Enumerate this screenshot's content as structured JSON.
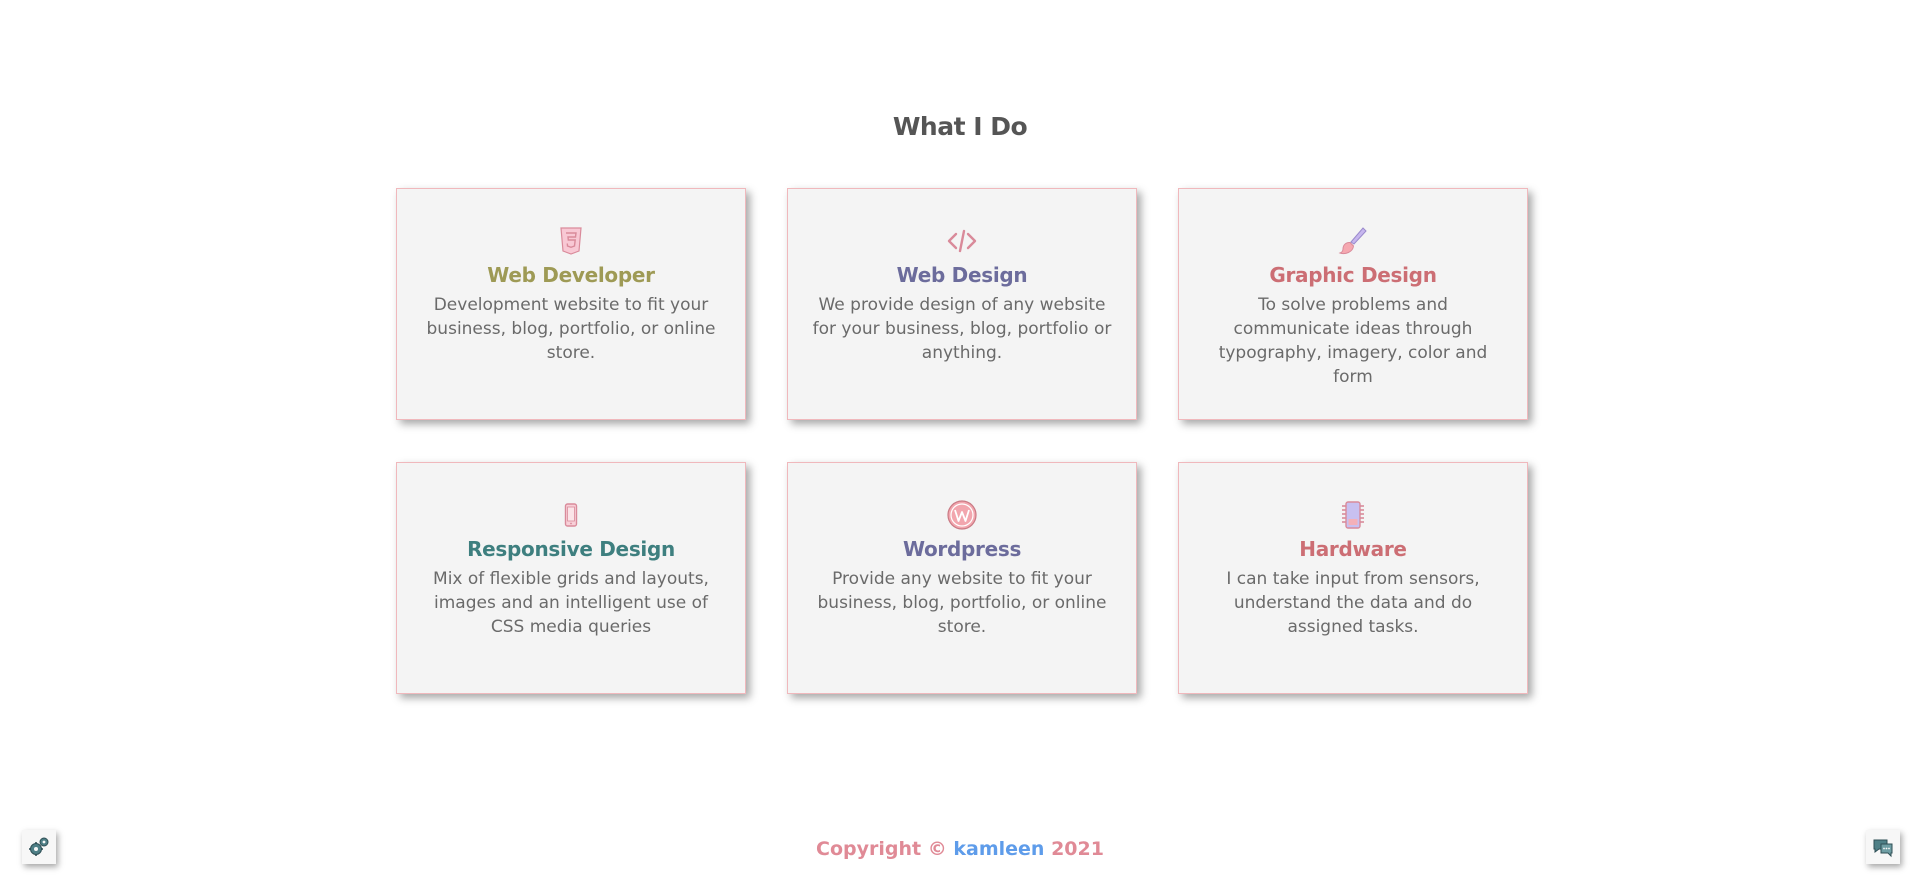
{
  "section": {
    "title": "What I Do"
  },
  "cards": [
    {
      "title": "Web Developer",
      "description": "Development website to fit your business, blog, portfolio, or online store.",
      "icon": "html5-icon",
      "color": "#9e9a55"
    },
    {
      "title": "Web Design",
      "description": "We provide design of any website for your business, blog, portfolio or anything.",
      "icon": "code-icon",
      "color": "#6c6c9c"
    },
    {
      "title": "Graphic Design",
      "description": "To solve problems and communicate ideas through typography, imagery, color and form",
      "icon": "paintbrush-icon",
      "color": "#cc6e74"
    },
    {
      "title": "Responsive Design",
      "description": "Mix of flexible grids and layouts, images and an intelligent use of CSS media queries",
      "icon": "mobile-icon",
      "color": "#3e7f7f"
    },
    {
      "title": "Wordpress",
      "description": "Provide any website to fit your business, blog, portfolio, or online store.",
      "icon": "wordpress-icon",
      "color": "#6c6c9c"
    },
    {
      "title": "Hardware",
      "description": "I can take input from sensors, understand the data and do assigned tasks.",
      "icon": "chip-icon",
      "color": "#cc6e74"
    }
  ],
  "footer": {
    "prefix": "Copyright ©",
    "brand": "kamleen",
    "year": "2021"
  },
  "corner_buttons": {
    "left_icon": "gears-icon",
    "right_icon": "chat-icon"
  }
}
